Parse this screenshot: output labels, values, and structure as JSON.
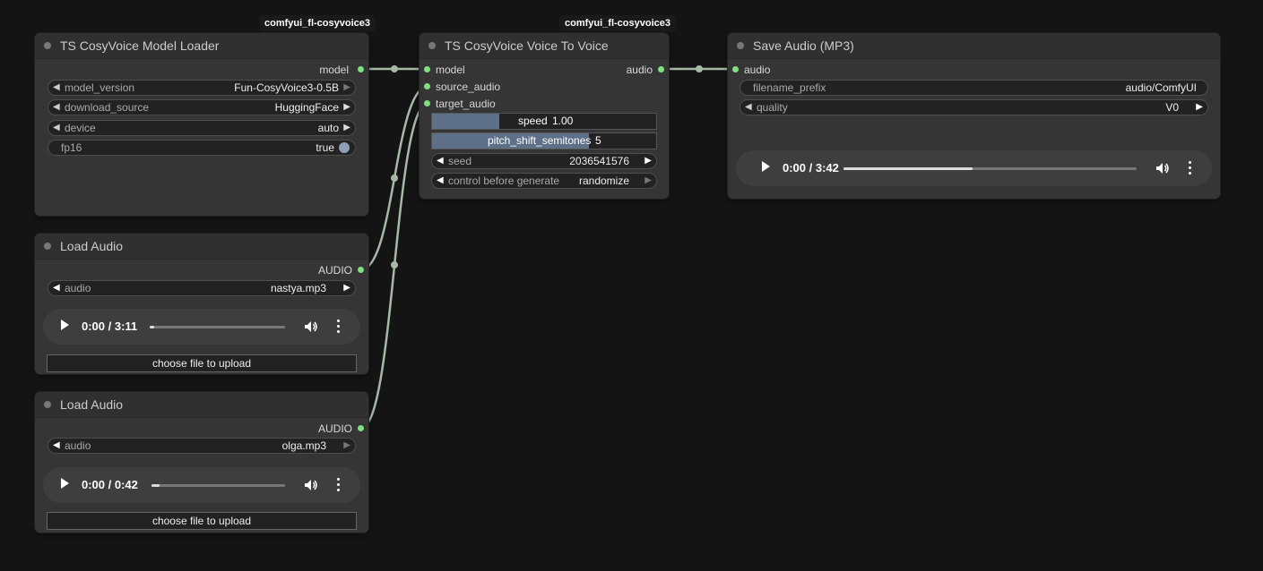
{
  "badges": [
    "comfyui_fl-cosyvoice3",
    "comfyui_fl-cosyvoice3"
  ],
  "model_loader": {
    "title": "TS CosyVoice Model Loader",
    "output": "model",
    "widgets": [
      {
        "label": "model_version",
        "value": "Fun-CosyVoice3-0.5B"
      },
      {
        "label": "download_source",
        "value": "HuggingFace"
      },
      {
        "label": "device",
        "value": "auto"
      },
      {
        "label": "fp16",
        "value": "true"
      }
    ]
  },
  "voice_to_voice": {
    "title": "TS CosyVoice Voice To Voice",
    "inputs": [
      "model",
      "source_audio",
      "target_audio"
    ],
    "output": "audio",
    "speed": {
      "label": "speed",
      "value": "1.00",
      "fill": 0.3
    },
    "pitch": {
      "label": "pitch_shift_semitones",
      "value": "5",
      "fill": 0.7
    },
    "seed": {
      "label": "seed",
      "value": "2036541576"
    },
    "control": {
      "label": "control before generate",
      "value": "randomize"
    }
  },
  "save_audio": {
    "title": "Save Audio (MP3)",
    "input": "audio",
    "filename": {
      "label": "filename_prefix",
      "value": "audio/ComfyUI"
    },
    "quality": {
      "label": "quality",
      "value": "V0"
    },
    "player": {
      "time": "0:00 / 3:42",
      "progress": 0.44
    }
  },
  "load_audio_1": {
    "title": "Load Audio",
    "output": "AUDIO",
    "audio": {
      "label": "audio",
      "value": "nastya.mp3"
    },
    "player": {
      "time": "0:00 / 3:11",
      "progress": 0.03
    },
    "upload_label": "choose file to upload"
  },
  "load_audio_2": {
    "title": "Load Audio",
    "output": "AUDIO",
    "audio": {
      "label": "audio",
      "value": "olga.mp3"
    },
    "player": {
      "time": "0:00 / 0:42",
      "progress": 0.06
    },
    "upload_label": "choose file to upload"
  },
  "colors": {
    "slot": "#7fe07f",
    "wire": "#a7b8a6",
    "slider_fill": "#5e7088"
  }
}
